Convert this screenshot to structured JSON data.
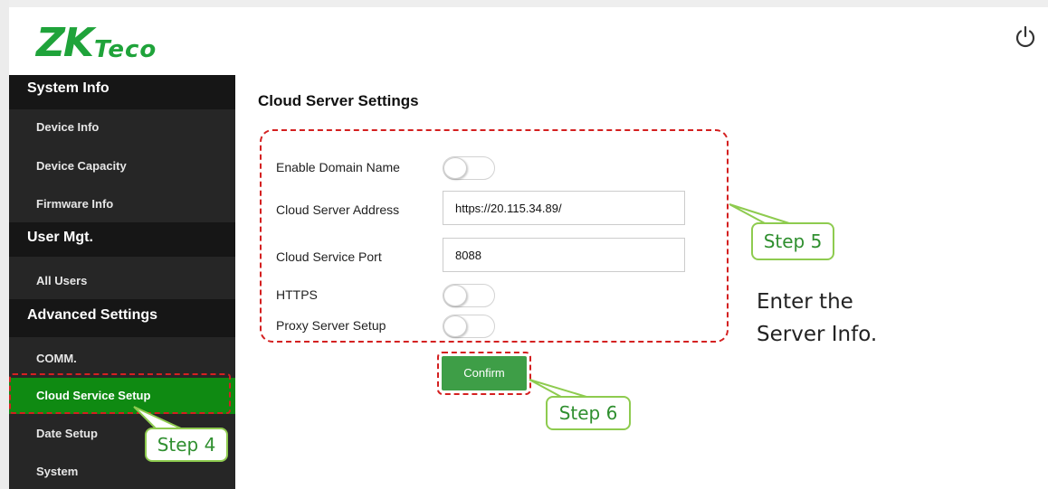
{
  "header": {
    "logo_main": "ZK",
    "logo_suffix": "Teco"
  },
  "sidebar": {
    "sections": [
      {
        "title": "System Info",
        "items": [
          "Device Info",
          "Device Capacity",
          "Firmware Info"
        ]
      },
      {
        "title": "User Mgt.",
        "items": [
          "All Users"
        ]
      },
      {
        "title": "Advanced Settings",
        "items": [
          "COMM.",
          "Cloud Service Setup",
          "Date Setup",
          "System"
        ]
      }
    ],
    "active_item": "Cloud Service Setup"
  },
  "main": {
    "title": "Cloud Server Settings",
    "fields": {
      "enable_domain_label": "Enable Domain Name",
      "enable_domain_on": false,
      "server_address_label": "Cloud Server Address",
      "server_address_value": "https://20.115.34.89/",
      "service_port_label": "Cloud Service Port",
      "service_port_value": "8088",
      "https_label": "HTTPS",
      "https_on": false,
      "proxy_label": "Proxy Server Setup",
      "proxy_on": false
    },
    "confirm_label": "Confirm"
  },
  "annotations": {
    "step4": "Step 4",
    "step5": "Step 5",
    "step6": "Step 6",
    "note_line1": "Enter the",
    "note_line2": "Server Info.",
    "callout_color": "#8ecb4f",
    "highlight_color": "#d42020"
  },
  "colors": {
    "brand_green": "#1fa33a",
    "sidebar_bg": "#262626",
    "section_bg": "#161616",
    "active_bg": "#0f8a12",
    "button_green": "#3e9e47"
  }
}
